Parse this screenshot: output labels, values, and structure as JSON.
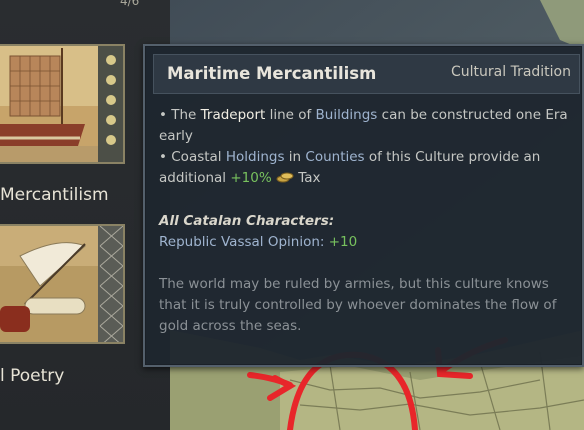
{
  "panel": {
    "page_counter": "4/6",
    "cards": [
      {
        "label": "Mercantilism",
        "image_icon": "ship-icon"
      },
      {
        "label": "l Poetry",
        "image_icon": "quill-scroll-icon"
      }
    ]
  },
  "tooltip": {
    "title": "Maritime Mercantilism",
    "subtitle": "Cultural Tradition",
    "line1_prefix": "• The ",
    "line1_building": "Tradeport",
    "line1_mid": " line of ",
    "line1_buildings_link": "Buildings",
    "line1_suffix": " can be constructed one Era",
    "line2": "early",
    "line3_prefix": "• Coastal ",
    "line3_holdings": "Holdings",
    "line3_mid": " in ",
    "line3_counties": "Counties",
    "line3_suffix": " of this Culture provide an",
    "line4_prefix": "additional ",
    "line4_value": "+10%",
    "line4_suffix": " Tax",
    "tax_icon": "gold-coins-icon",
    "section_heading": "All Catalan Characters:",
    "modifier_label": "Republic Vassal Opinion: ",
    "modifier_value": "+10",
    "flavor_lines": [
      "The world may be ruled by armies, but this culture knows",
      "that it is truly controlled by whoever dominates the flow of",
      "gold across the seas."
    ]
  },
  "colors": {
    "annotation_red": "#e8262a",
    "tooltip_bg": "#1e262f",
    "positive_green": "#78c25e",
    "link_blue": "#9fb4cf"
  }
}
